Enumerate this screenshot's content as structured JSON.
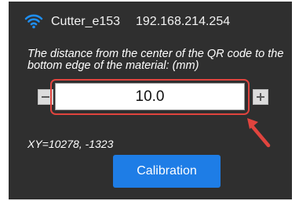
{
  "header": {
    "wifi_icon": "wifi-icon",
    "device_name": "Cutter_e153",
    "ip_address": "192.168.214.254"
  },
  "form": {
    "instructions": "The distance from the center of the QR code to the bottom edge of the material: (mm)",
    "decrement_icon": "minus-icon",
    "increment_icon": "plus-icon",
    "distance_value": "10.0"
  },
  "status": {
    "xy_readout": "XY=10278, -1323"
  },
  "actions": {
    "calibration_label": "Calibration"
  },
  "colors": {
    "panel_background": "#2f2f2f",
    "wifi": "#1f8ef1",
    "primary_button": "#1e7de6",
    "annotation": "#e0443e"
  }
}
